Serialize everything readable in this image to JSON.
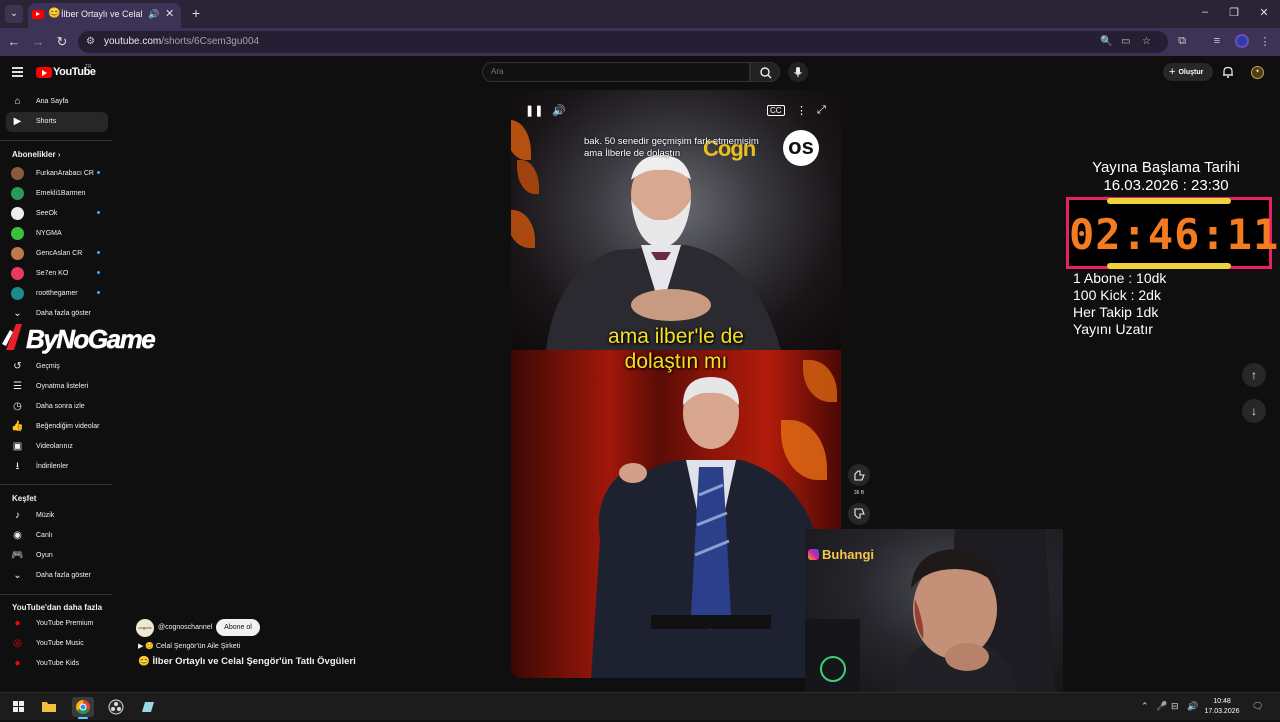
{
  "browser": {
    "tab_title": "İlber Ortaylı ve Celal Şengör'ün Tatlı Övgüleri",
    "tab_emoji": "😊",
    "new_tab": "+",
    "url_domain": "youtube.com",
    "url_path": "/shorts/6Csem3gu004"
  },
  "youtube": {
    "logo_text": "YouTube",
    "country_code": "TR",
    "search_placeholder": "Ara",
    "create_label": "Oluştur"
  },
  "sidebar": {
    "main": [
      {
        "label": "Ana Sayfa",
        "icon": "home-icon"
      },
      {
        "label": "Shorts",
        "icon": "shorts-icon"
      }
    ],
    "subscriptions_title": "Abonelikler",
    "subscriptions": [
      {
        "label": "FurkanArabacı CR",
        "color": "#8a5a3c",
        "dot": true
      },
      {
        "label": "Emekli1Barmen",
        "color": "#2a9a5a",
        "dot": false
      },
      {
        "label": "SeeOk",
        "color": "#eeeeee",
        "dot": true
      },
      {
        "label": "NYGMA",
        "color": "#3ac03a",
        "dot": false
      },
      {
        "label": "GencAslan CR",
        "color": "#c07a4a",
        "dot": true
      },
      {
        "label": "Se7en KO",
        "color": "#e83a5a",
        "dot": true
      },
      {
        "label": "rootthegamer",
        "color": "#1a8a8a",
        "dot": true
      }
    ],
    "show_more": "Daha fazla göster",
    "you_items": [
      {
        "label": "Geçmiş",
        "icon": "history-icon"
      },
      {
        "label": "Oynatma listeleri",
        "icon": "playlists-icon"
      },
      {
        "label": "Daha sonra izle",
        "icon": "watch-later-icon"
      },
      {
        "label": "Beğendiğim videolar",
        "icon": "liked-videos-icon"
      },
      {
        "label": "Videolarınız",
        "icon": "your-videos-icon"
      },
      {
        "label": "İndirilenler",
        "icon": "downloads-icon"
      }
    ],
    "explore_title": "Keşfet",
    "explore": [
      {
        "label": "Müzik",
        "icon": "music-icon"
      },
      {
        "label": "Canlı",
        "icon": "live-icon"
      },
      {
        "label": "Oyun",
        "icon": "gaming-icon"
      },
      {
        "label": "Daha fazla göster",
        "icon": "chevron-down-icon"
      }
    ],
    "more_title": "YouTube'dan daha fazla",
    "more": [
      {
        "label": "YouTube Premium",
        "color": "#ff0000"
      },
      {
        "label": "YouTube Music",
        "color": "#ff0000"
      },
      {
        "label": "YouTube Kids",
        "color": "#ff0000"
      }
    ]
  },
  "overlay_logo": "ByNoGame",
  "short": {
    "subtitle_top": "bak. 50 senedir geçmişim fark etmemişim\nama İlberle de dolaştın",
    "brand_text": "Cogn",
    "brand_circle": "os",
    "caption": "ama ilber'le de\ndolaştın mı",
    "like_count": "36 B",
    "channel": "@cognoschannel",
    "subscribe": "Abone ol",
    "playlist": "😊 Celal Şengör'ün Aile Şirketi",
    "title_emoji": "😊",
    "title": "İlber Ortaylı ve Celal Şengör'ün Tatlı Övgüleri"
  },
  "stream": {
    "start_label": "Yayına Başlama Tarihi",
    "start_date": "16.03.2026 : 23:30",
    "timer": "02:46:11",
    "rules": [
      "1 Abone : 10dk",
      "100 Kick : 2dk",
      "Her Takip 1dk",
      "Yayını Uzatır"
    ],
    "webcam_name": "Buhangi"
  },
  "taskbar": {
    "time": "10:48",
    "date": "17.03.2026"
  }
}
